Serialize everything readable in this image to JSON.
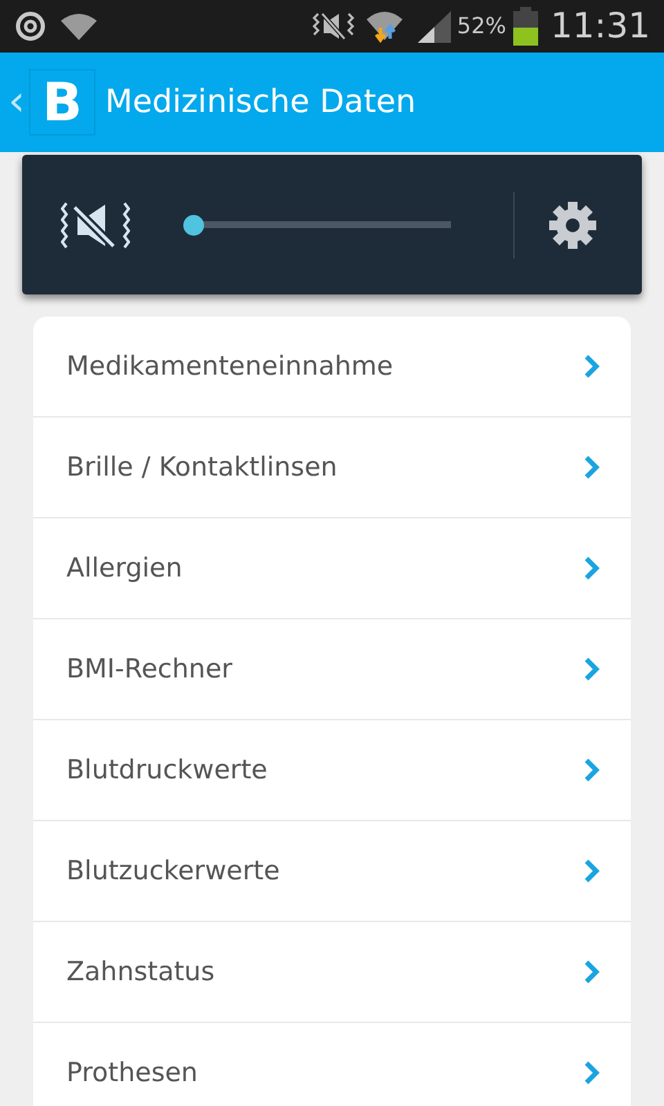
{
  "status_bar": {
    "battery": "52%",
    "time": "11:31"
  },
  "app_bar": {
    "back": "‹",
    "logo": "B",
    "title": "Medizinische Daten"
  },
  "volume_panel": {
    "level": 0.0
  },
  "menu_items": [
    {
      "label": "Medikamenteneinnahme"
    },
    {
      "label": "Brille / Kontaktlinsen"
    },
    {
      "label": "Allergien"
    },
    {
      "label": "BMI-Rechner"
    },
    {
      "label": "Blutdruckwerte"
    },
    {
      "label": "Blutzuckerwerte"
    },
    {
      "label": "Zahnstatus"
    },
    {
      "label": "Prothesen"
    }
  ]
}
